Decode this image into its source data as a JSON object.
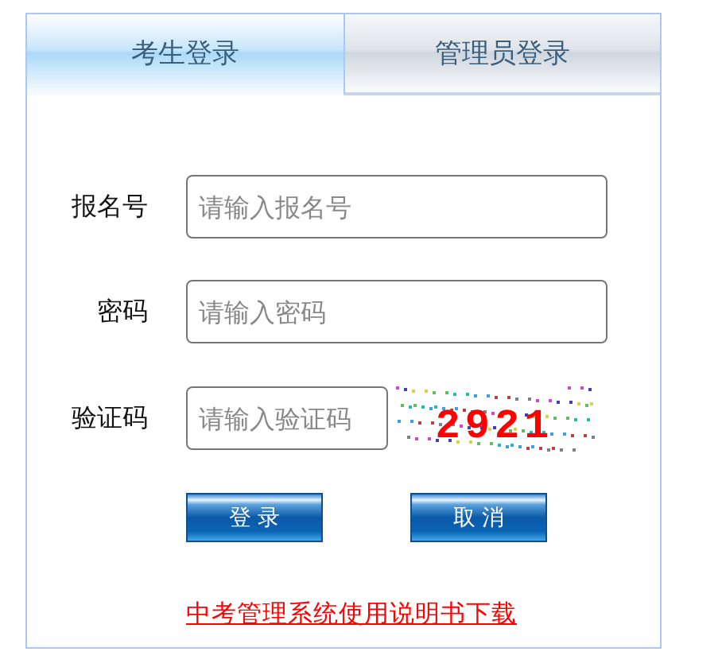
{
  "tabs": [
    {
      "label": "考生登录",
      "selected": true
    },
    {
      "label": "管理员登录",
      "selected": false
    }
  ],
  "fields": [
    {
      "label": "报名号",
      "placeholder": "请输入报名号",
      "kind": "text"
    },
    {
      "label": "密码",
      "placeholder": "请输入密码",
      "kind": "password"
    },
    {
      "label": "验证码",
      "placeholder": "请输入验证码",
      "kind": "captcha",
      "captcha": "2921"
    }
  ],
  "buttons": [
    "登 录",
    "取 消"
  ],
  "link": "中考管理系统使用说明书下载"
}
